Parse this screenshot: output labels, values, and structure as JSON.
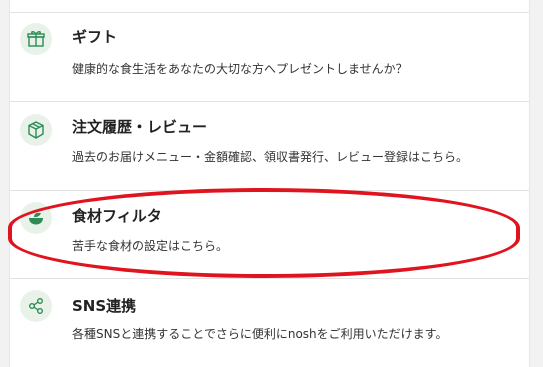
{
  "menu": {
    "items": [
      {
        "icon": "gift-icon",
        "title": "ギフト",
        "description": "健康的な食生活をあなたの大切な方へプレゼントしませんか？"
      },
      {
        "icon": "box-icon",
        "title": "注文履歴・レビュー",
        "description": "過去のお届けメニュー・金額確認、領収書発行、レビュー登録はこちら。"
      },
      {
        "icon": "food-bowl-icon",
        "title": "食材フィルタ",
        "description": "苦手な食材の設定はこちら。"
      },
      {
        "icon": "share-icon",
        "title": "SNS連携",
        "description": "各種SNSと連携することでさらに便利にnoshをご利用いただけます。"
      }
    ],
    "highlighted_item": "食材フィルタ"
  },
  "colors": {
    "icon_green": "#2e8b57",
    "icon_background": "#e8f2e9",
    "highlight_red": "#e0141f"
  }
}
